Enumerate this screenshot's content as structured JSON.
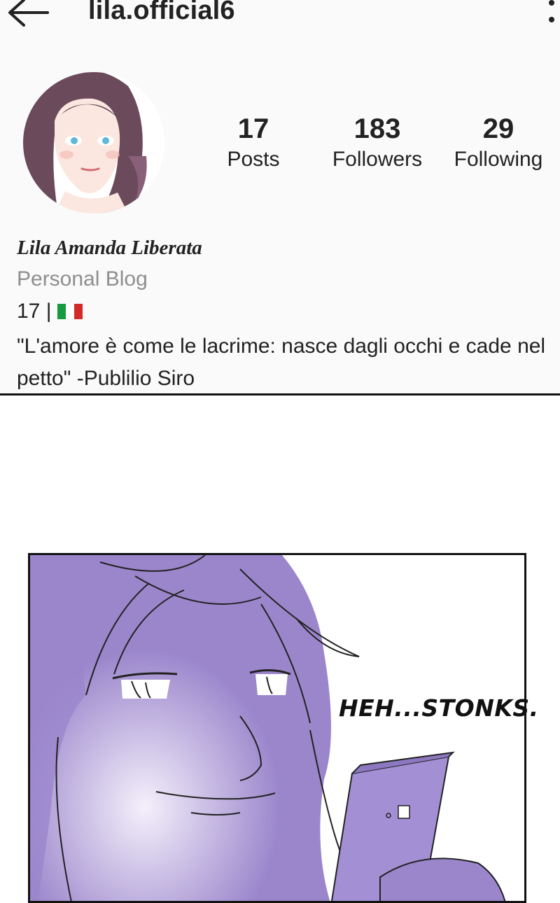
{
  "header": {
    "username": "lila.official6",
    "back_icon": "arrow-left-icon",
    "more_icon": "more-vertical-icon"
  },
  "profile": {
    "avatar_icon": "avatar-illustration",
    "stats": [
      {
        "value": "17",
        "label": "Posts"
      },
      {
        "value": "183",
        "label": "Followers"
      },
      {
        "value": "29",
        "label": "Following"
      }
    ]
  },
  "bio": {
    "name": "Lila Amanda Liberata",
    "category": "Personal Blog",
    "age_line": "17 |",
    "flag_icon": "italy-flag-icon",
    "quote": "\"L'amore è come le lacrime: nasce dagli occhi e cade nel petto\" -Publilio Siro"
  },
  "comic": {
    "caption": "HEH...STONKS.",
    "colors": {
      "purple": "#9b86cc",
      "light_purple": "#c9bdea"
    }
  },
  "colors": {
    "secondary_text": "#8e8e8e",
    "flag_green": "#169b3e",
    "flag_white": "#ffffff",
    "flag_red": "#d32a2a"
  }
}
